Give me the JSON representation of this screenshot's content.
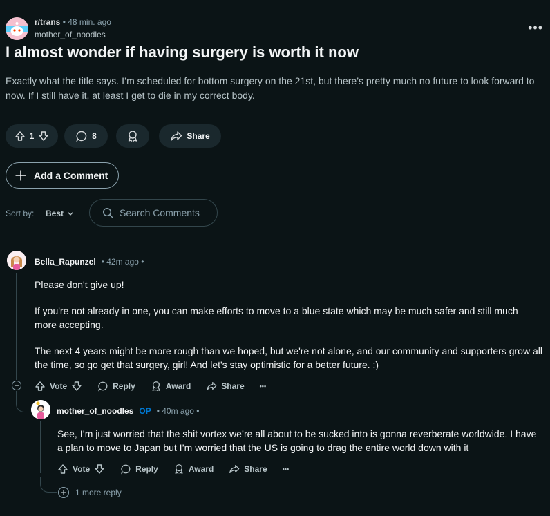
{
  "post": {
    "subreddit": "r/trans",
    "time": "• 48 min. ago",
    "author": "mother_of_noodles",
    "more": "•••",
    "title": "I almost wonder if having surgery is worth it now",
    "body": "Exactly what the title says. I’m scheduled for bottom surgery on the 21st, but there’s pretty much no future to look forward to now. If I still have it, at least I get to die in my correct body.",
    "votes": "1",
    "comments": "8",
    "share": "Share"
  },
  "add_comment": "Add a Comment",
  "sort": {
    "label": "Sort by:",
    "value": "Best"
  },
  "search": {
    "placeholder": "Search Comments"
  },
  "comments": [
    {
      "user": "Bella_Rapunzel",
      "meta": "• 42m ago •",
      "paragraphs": [
        "Please don't give up!",
        "If you're not already in one, you can make efforts to move to a blue state which may be much safer and still much more accepting.",
        "The next 4 years might be more rough than we hoped, but we're not alone, and our community and supporters grow all the time, so go get that surgery, girl! And let's stay optimistic for a better future. :)"
      ],
      "actions": {
        "vote": "Vote",
        "reply": "Reply",
        "award": "Award",
        "share": "Share",
        "more": "•••"
      }
    },
    {
      "user": "mother_of_noodles",
      "op": "OP",
      "meta": "• 40m ago •",
      "paragraphs": [
        "See, I’m just worried that the shit vortex we’re all about to be sucked into is gonna reverberate worldwide. I have a plan to move to Japan but I’m worried that the US is going to drag the entire world down with it"
      ],
      "actions": {
        "vote": "Vote",
        "reply": "Reply",
        "award": "Award",
        "share": "Share",
        "more": "•••"
      },
      "more_replies": "1 more reply"
    }
  ],
  "colors": {
    "background": "#0b1416",
    "pill": "#1a282d",
    "op": "#0079d3"
  }
}
